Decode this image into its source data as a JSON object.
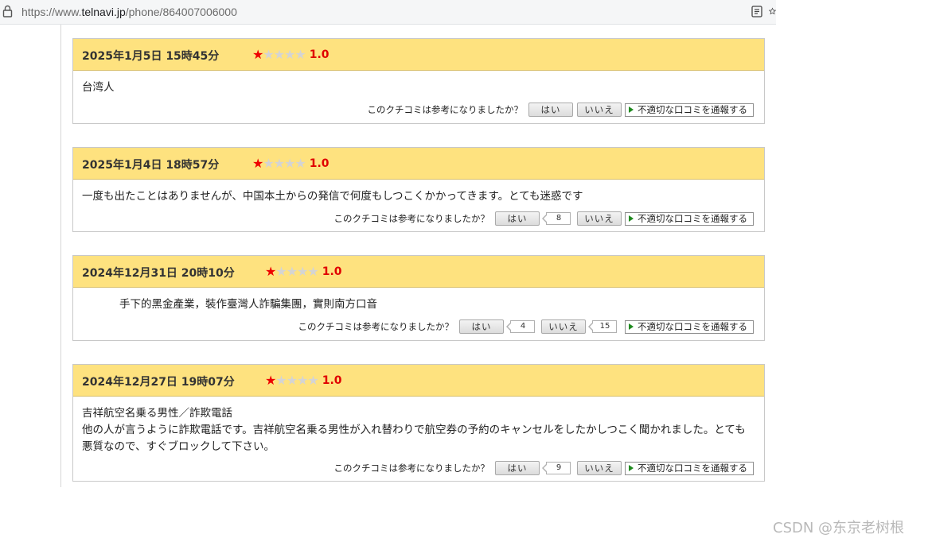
{
  "browser": {
    "url_prefix": "https://www.",
    "url_host": "telnavi.jp",
    "url_path": "/phone/864007006000"
  },
  "helpful_question": "このクチコミは参考になりましたか？",
  "yes_label": "はい",
  "no_label": "いいえ",
  "report_label": "不適切な口コミを通報する",
  "reviews": [
    {
      "date": "2025年1月5日 15時45分",
      "rating": "1.0",
      "rating_value": 1,
      "text": "台湾人",
      "text2": "",
      "yes_count": "",
      "no_count": ""
    },
    {
      "date": "2025年1月4日 18時57分",
      "rating": "1.0",
      "rating_value": 1,
      "text": "一度も出たことはありませんが、中国本土からの発信で何度もしつこくかかってきます。とても迷惑です",
      "text2": "",
      "yes_count": "8",
      "no_count": ""
    },
    {
      "date": "2024年12月31日 20時10分",
      "rating": "1.0",
      "rating_value": 1,
      "text": "手下的黑金產業，裝作臺灣人詐騙集團，實則南方口音",
      "text2": "",
      "yes_count": "4",
      "no_count": "15"
    },
    {
      "date": "2024年12月27日 19時07分",
      "rating": "1.0",
      "rating_value": 1,
      "text": "吉祥航空名乗る男性／詐欺電話",
      "text2": "他の人が言うように詐欺電話です。吉祥航空名乗る男性が入れ替わりで航空券の予約のキャンセルをしたかしつこく聞かれました。とても悪質なので、すぐブロックして下さい。",
      "yes_count": "9",
      "no_count": ""
    }
  ],
  "watermark": "CSDN @东京老树根",
  "colors": {
    "header_bg": "#fee27f",
    "star_on": "#ee0000",
    "star_off": "#d4d4d4",
    "rating_text": "#e00000",
    "report_arrow": "#1f8a1f"
  },
  "icons": [
    "lock-icon",
    "reader-view-icon",
    "favorite-star-icon",
    "star-icon",
    "play-arrow-icon"
  ]
}
